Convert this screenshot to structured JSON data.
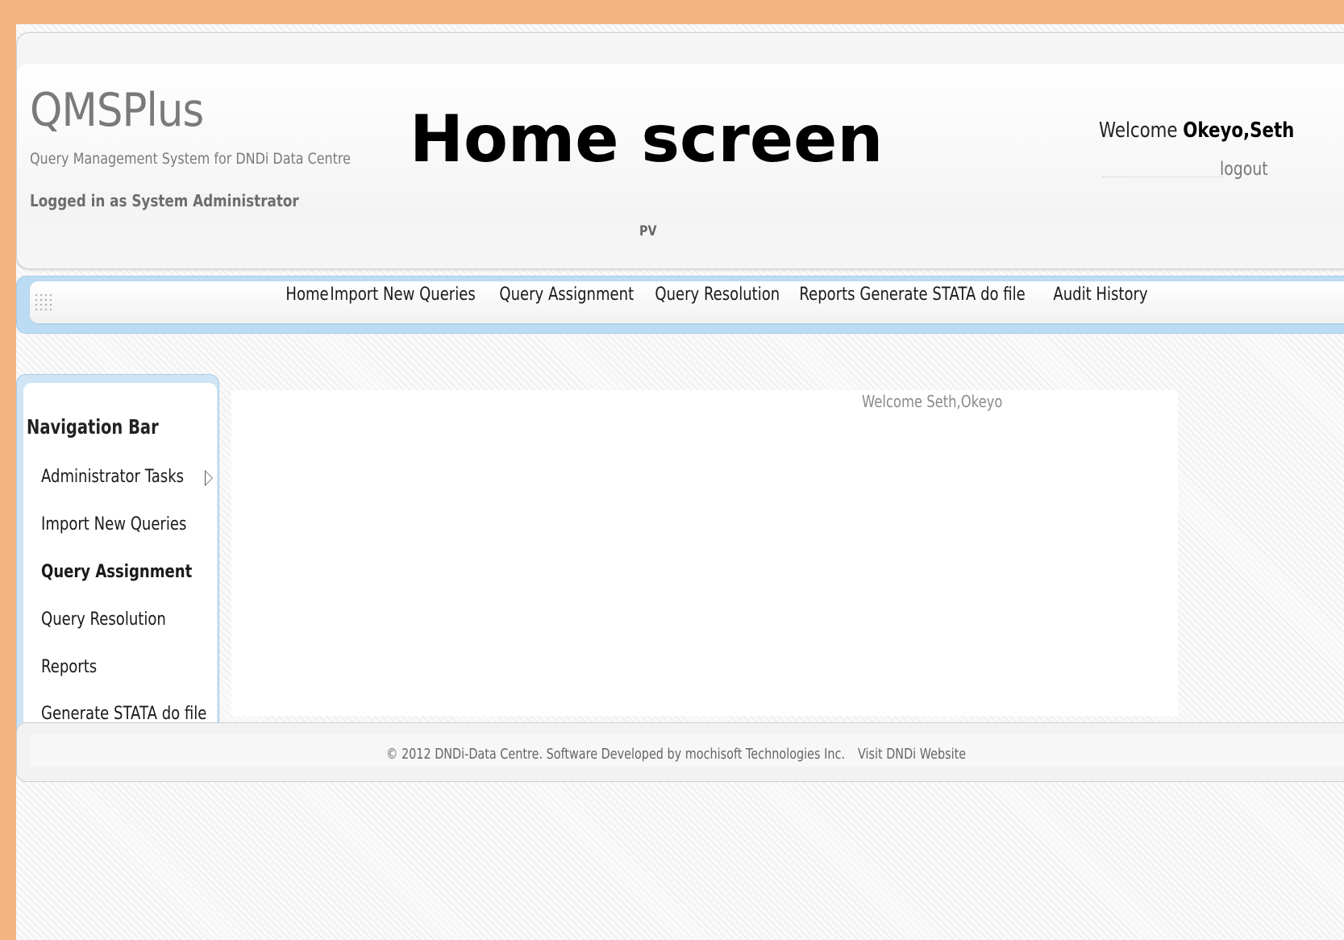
{
  "header": {
    "app_name": "QMSPlus",
    "app_subtitle": "Query Management System for DNDi Data Centre",
    "logged_in": "Logged in as System Administrator",
    "slide_title": "Home screen",
    "project_code": "PV",
    "welcome_prefix": "Welcome",
    "welcome_name": "Okeyo,Seth",
    "logout_label": "logout"
  },
  "menu": {
    "items": [
      {
        "label": "Home"
      },
      {
        "label": "Import New Queries"
      },
      {
        "label": "Query Assignment"
      },
      {
        "label": "Query Resolution"
      },
      {
        "label": "Reports"
      },
      {
        "label": "Generate STATA do file"
      },
      {
        "label": "Audit History"
      }
    ]
  },
  "sidebar": {
    "heading": "Navigation Bar",
    "items": [
      {
        "label": "Administrator Tasks",
        "icon": "submenu-arrow-icon"
      },
      {
        "label": "Import New Queries"
      },
      {
        "label": "Query Assignment",
        "active": true
      },
      {
        "label": "Query Resolution"
      },
      {
        "label": "Reports"
      },
      {
        "label": "Generate STATA do file"
      }
    ]
  },
  "content": {
    "welcome": "Welcome Seth,Okeyo"
  },
  "footer": {
    "copyright": "© 2012 DNDi-Data Centre. Software Developed by mochisoft Technologies Inc.",
    "link_label": "Visit DNDi Website"
  },
  "colors": {
    "slide_background": "#f2b483",
    "menu_border": "#bcdcf3",
    "text_muted": "#7a7a7a"
  }
}
